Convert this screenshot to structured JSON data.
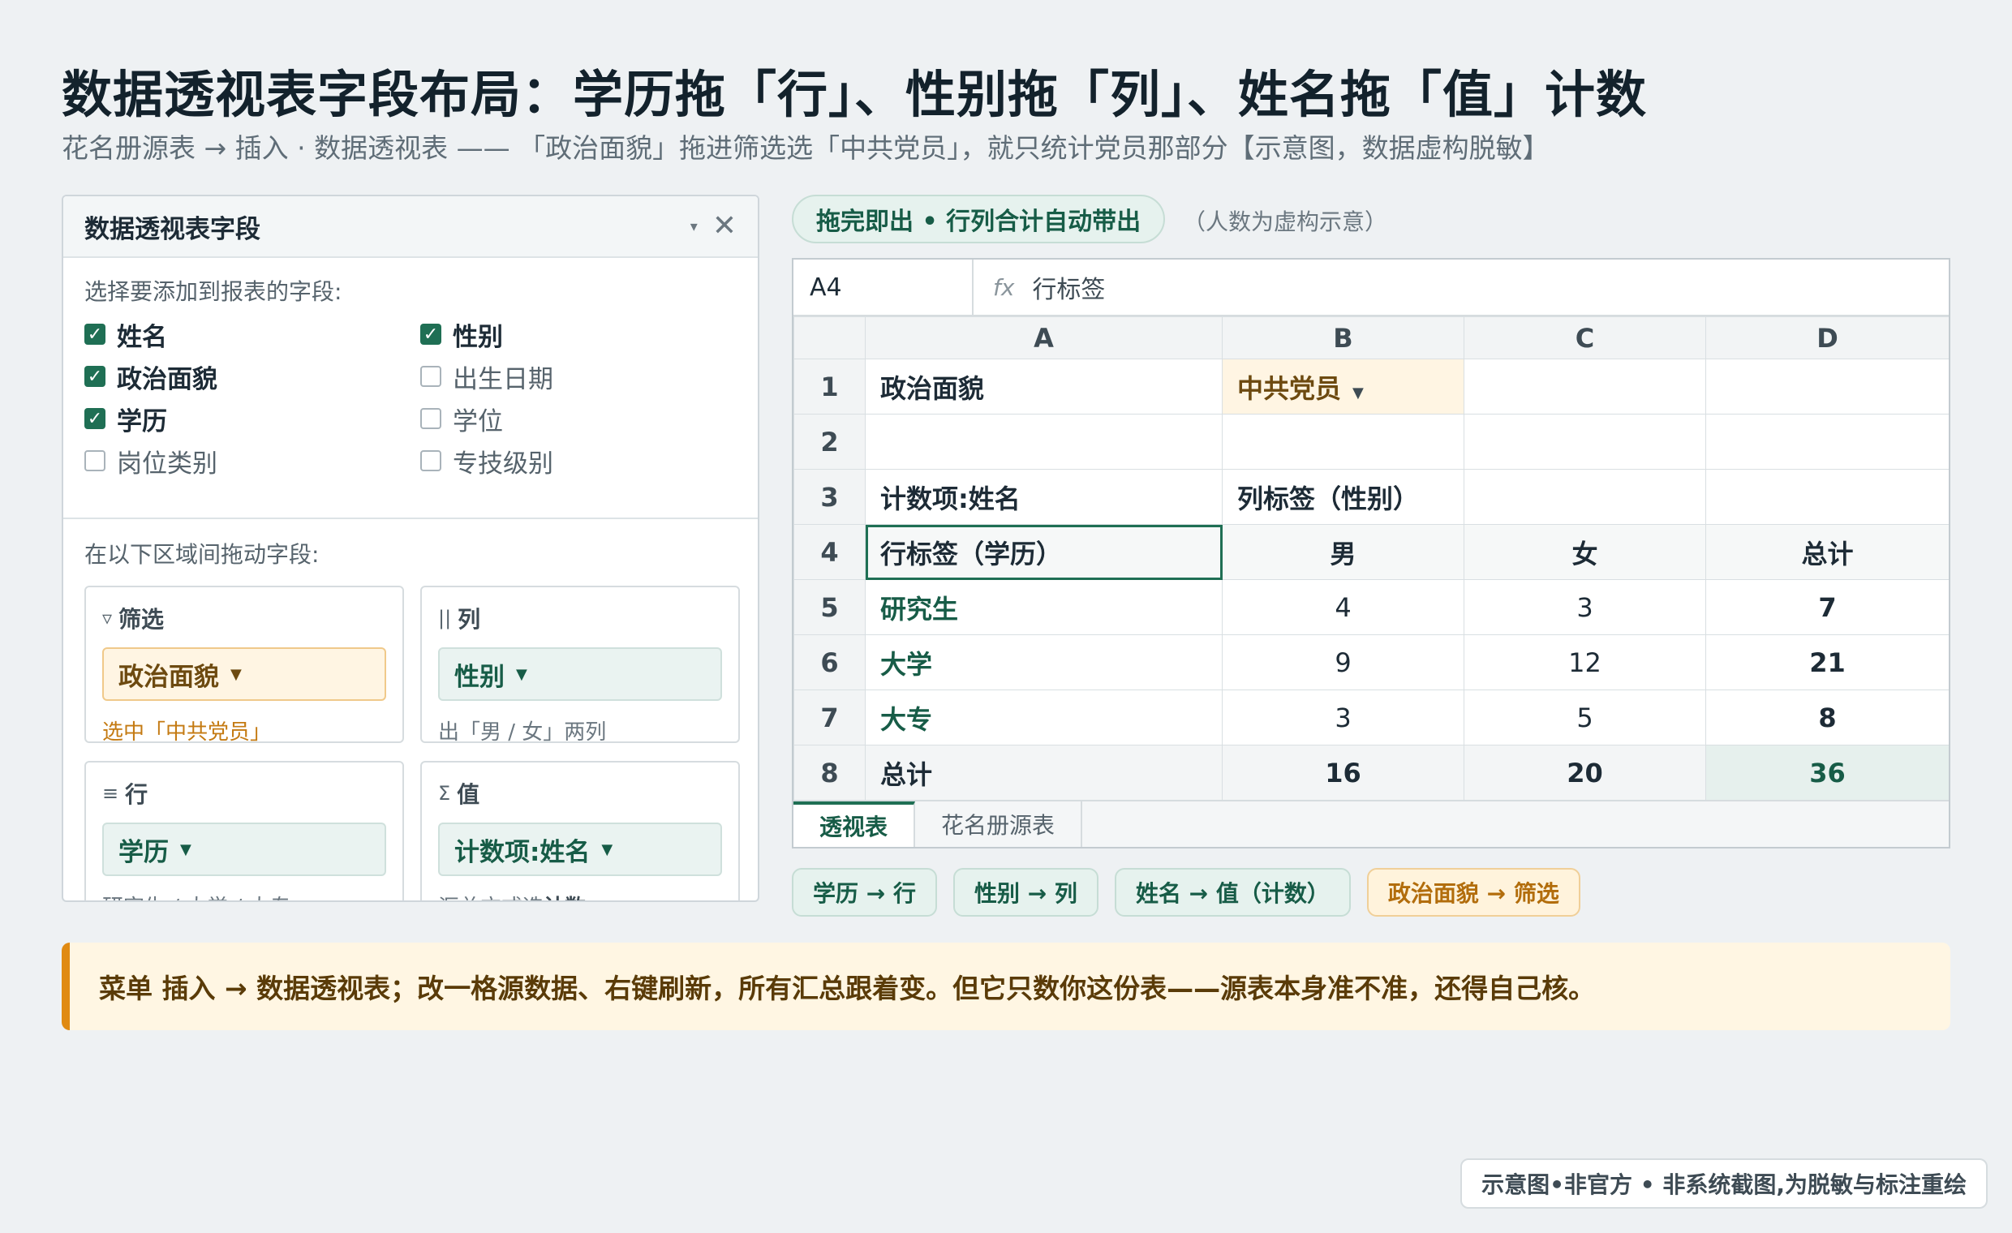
{
  "page": {
    "title": "数据透视表字段布局：学历拖「行」、性别拖「列」、姓名拖「值」计数",
    "subtitle": "花名册源表 → 插入 · 数据透视表 —— 「政治面貌」拖进筛选选「中共党员」，就只统计党员那部分【示意图，数据虚构脱敏】"
  },
  "panel": {
    "title": "数据透视表字段",
    "caret_icon": "▾",
    "close_icon": "✕",
    "choose_label": "选择要添加到报表的字段:",
    "fields": [
      {
        "name": "姓名",
        "checked": true
      },
      {
        "name": "性别",
        "checked": true
      },
      {
        "name": "政治面貌",
        "checked": true
      },
      {
        "name": "出生日期",
        "checked": false
      },
      {
        "name": "学历",
        "checked": true
      },
      {
        "name": "学位",
        "checked": false
      },
      {
        "name": "岗位类别",
        "checked": false
      },
      {
        "name": "专技级别",
        "checked": false
      }
    ],
    "drag_label": "在以下区域间拖动字段:",
    "areas": {
      "filter": {
        "glyph": "▿",
        "title": "筛选",
        "chip": "政治面貌",
        "note": "选中「中共党员」"
      },
      "columns": {
        "glyph": "||",
        "title": "列",
        "chip": "性别",
        "note": "出「男 / 女」两列"
      },
      "rows": {
        "glyph": "≡",
        "title": "行",
        "chip": "学历",
        "note": "研究生 / 大学 / 大专..."
      },
      "values": {
        "glyph": "Σ",
        "title": "值",
        "chip": "计数项:姓名",
        "note_prefix": "汇总方式选",
        "note_bold": "计数"
      }
    }
  },
  "top_pill": "拖完即出 • 行列合计自动带出",
  "pill_note": "（人数为虚构示意）",
  "sheet": {
    "name_box": "A4",
    "fx": "fx",
    "formula": "行标签",
    "columns": [
      "A",
      "B",
      "C",
      "D"
    ],
    "rows": [
      {
        "num": "1",
        "a": "政治面貌",
        "b": "中共党员",
        "c": "",
        "d": ""
      },
      {
        "num": "2",
        "a": "",
        "b": "",
        "c": "",
        "d": ""
      },
      {
        "num": "3",
        "a": "计数项:姓名",
        "b": "列标签（性别）",
        "c": "",
        "d": ""
      },
      {
        "num": "4",
        "a": "行标签（学历）",
        "b": "男",
        "c": "女",
        "d": "总计"
      },
      {
        "num": "5",
        "a": "研究生",
        "b": "4",
        "c": "3",
        "d": "7"
      },
      {
        "num": "6",
        "a": "大学",
        "b": "9",
        "c": "12",
        "d": "21"
      },
      {
        "num": "7",
        "a": "大专",
        "b": "3",
        "c": "5",
        "d": "8"
      },
      {
        "num": "8",
        "a": "总计",
        "b": "16",
        "c": "20",
        "d": "36"
      }
    ],
    "filter_caret": "▼",
    "tabs": [
      "透视表",
      "花名册源表"
    ]
  },
  "mapping": [
    "学历 → 行",
    "性别 → 列",
    "姓名 → 值（计数）",
    "政治面貌 → 筛选"
  ],
  "callout": "菜单 插入 → 数据透视表；改一格源数据、右键刷新，所有汇总跟着变。但它只数你这份表——源表本身准不准，还得自己核。",
  "footer": "示意图•非官方 • 非系统截图,为脱敏与标注重绘",
  "colors": {
    "accent_green": "#1f6f54",
    "accent_orange": "#e08a12"
  }
}
